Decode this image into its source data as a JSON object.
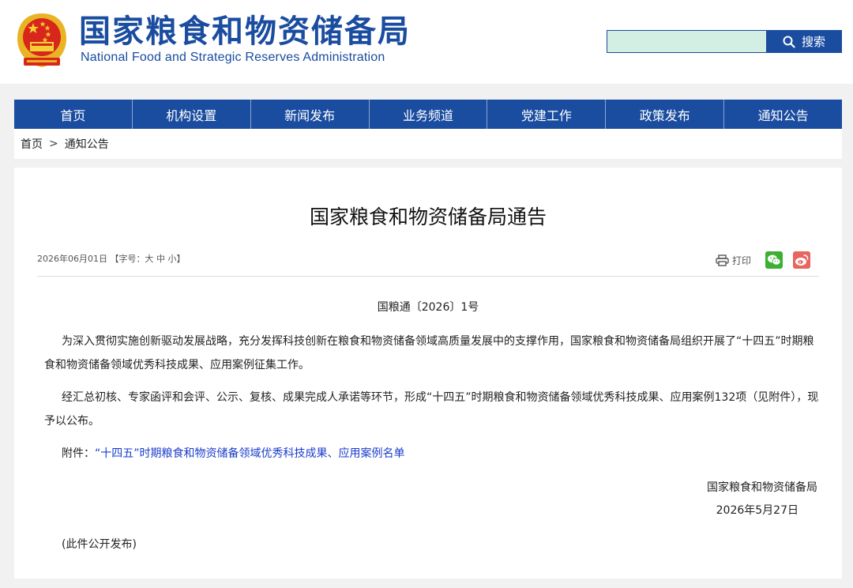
{
  "header": {
    "site_name_cn": "国家粮食和物资储备局",
    "site_name_en": "National Food and Strategic Reserves Administration",
    "search": {
      "value": "",
      "button_label": "搜索"
    }
  },
  "nav": {
    "items": [
      "首页",
      "机构设置",
      "新闻发布",
      "业务频道",
      "党建工作",
      "政策发布",
      "通知公告"
    ]
  },
  "breadcrumb": {
    "home": "首页",
    "separator": ">",
    "current": "通知公告"
  },
  "article": {
    "title": "国家粮食和物资储备局通告",
    "date": "2026年06月01日",
    "font_size_label": "【字号：",
    "font_sizes": [
      "大",
      "中",
      "小"
    ],
    "font_size_close": "】",
    "print_label": "打印",
    "doc_number": "国粮通〔2026〕1号",
    "paragraphs": [
      "为深入贯彻实施创新驱动发展战略，充分发挥科技创新在粮食和物资储备领域高质量发展中的支撑作用，国家粮食和物资储备局组织开展了“十四五”时期粮食和物资储备领域优秀科技成果、应用案例征集工作。",
      "经汇总初核、专家函评和会评、公示、复核、成果完成人承诺等环节，形成“十四五”时期粮食和物资储备领域优秀科技成果、应用案例132项（见附件），现予以公布。"
    ],
    "attachment_label": "附件：",
    "attachment_link": "“十四五”时期粮食和物资储备领域优秀科技成果、应用案例名单",
    "sign_org": "国家粮食和物资储备局",
    "sign_date": "2026年5月27日",
    "public_note": "(此件公开发布)"
  },
  "colors": {
    "brand_blue": "#1a4ca0",
    "link_blue": "#1a3ccc",
    "wechat_green": "#3cb034",
    "weibo_red": "#e8665f"
  },
  "icons": [
    "national-emblem-icon",
    "search-icon",
    "print-icon",
    "wechat-icon",
    "weibo-icon"
  ]
}
